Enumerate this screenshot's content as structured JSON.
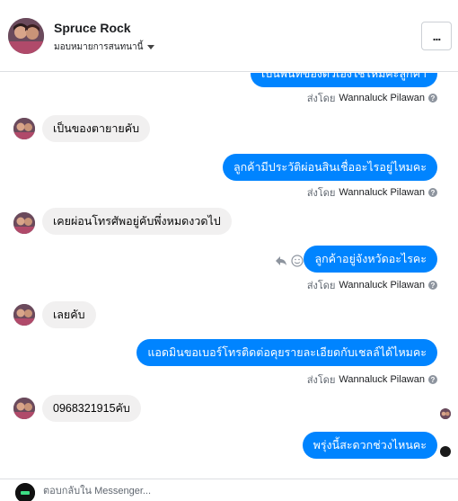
{
  "header": {
    "contact_name": "Spruce Rock",
    "assign_label": "มอบหมายการสนทนานี้",
    "more_label": "..."
  },
  "thread": {
    "cropped_top": {
      "text": "เป็นพันที่ของตัวเองใช่ไหมคะลูกค้า",
      "sent_by_prefix": "ส่งโดย",
      "sent_by_name": "Wannaluck Pilawan"
    },
    "messages": [
      {
        "from": "customer",
        "text": "เป็นของตายายคับ"
      },
      {
        "from": "page",
        "text": "ลูกค้ามีประวัติผ่อนสินเชื่ออะไรอยู่ไหมคะ",
        "sent_by_prefix": "ส่งโดย",
        "sent_by_name": "Wannaluck Pilawan"
      },
      {
        "from": "customer",
        "text": "เคยผ่อนโทรศัพอยู่คับพึ่งหมดงวดไป"
      },
      {
        "from": "page",
        "text": "ลูกค้าอยู่จังหวัดอะไรคะ",
        "sent_by_prefix": "ส่งโดย",
        "sent_by_name": "Wannaluck Pilawan"
      },
      {
        "from": "customer",
        "text": "เลยคับ"
      },
      {
        "from": "page",
        "text": "แอดมินขอเบอร์โทรติดต่อคุยรายละเอียดกับเชลล์ได้ไหมคะ",
        "sent_by_prefix": "ส่งโดย",
        "sent_by_name": "Wannaluck Pilawan"
      },
      {
        "from": "customer",
        "text": "0968321915คับ"
      },
      {
        "from": "page",
        "text": "พรุ่งนี้สะดวกช่วงไหนคะ"
      }
    ]
  },
  "icons": {
    "help": "question-circle-icon",
    "reply": "reply-icon",
    "react": "smiley-icon",
    "caret": "caret-down-icon"
  },
  "composer": {
    "placeholder": "ตอบกลับใน Messenger..."
  },
  "colors": {
    "outgoing_bubble": "#0084ff",
    "incoming_bubble": "#f1f0f0"
  }
}
